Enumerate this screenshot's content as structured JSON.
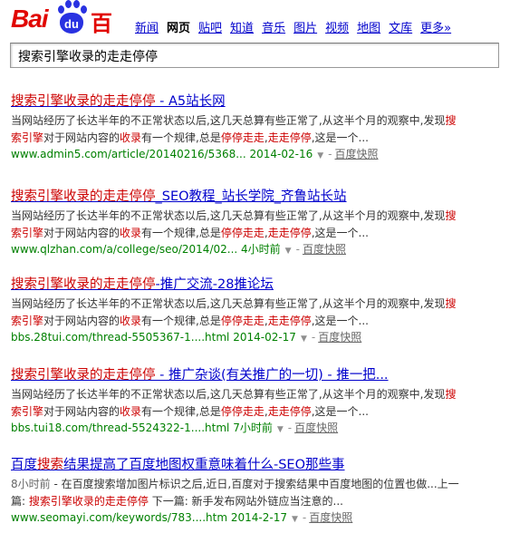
{
  "logo": {
    "part1": "Bai",
    "paw_text": "du",
    "part2": "百度"
  },
  "nav": {
    "items": [
      "新闻",
      "网页",
      "贴吧",
      "知道",
      "音乐",
      "图片",
      "视频",
      "地图",
      "文库",
      "更多»"
    ],
    "active": "网页"
  },
  "search": {
    "value": "搜索引擎收录的走走停停"
  },
  "results": [
    {
      "title_hl": "搜索引擎收录的走走停停",
      "title_rest": " - A5站长网",
      "abs_line1_a": "当网站经历了长达半年的不正常状态以后,这几天总算有些正常了,从这半个月的观察中,发现",
      "abs_line1_hl": "搜",
      "abs_line2_hl1": "索引擎",
      "abs_line2_a": "对于网站内容的",
      "abs_line2_hl2": "收录",
      "abs_line2_b": "有一个规律,总是",
      "abs_line2_hl3": "停停走走",
      "abs_line2_c": ",",
      "abs_line2_hl4": "走走停停",
      "abs_line2_d": ",这是一个...",
      "url": "www.admin5.com/article/20140216/5368...",
      "date": "2014-02-16",
      "cache": "百度快照"
    },
    {
      "title_hl": "搜索引擎收录的走走停停",
      "title_rest": "_SEO教程_站长学院_齐鲁站长站",
      "abs_line1_a": "当网站经历了长达半年的不正常状态以后,这几天总算有些正常了,从这半个月的观察中,发现",
      "abs_line1_hl": "搜",
      "abs_line2_hl1": "索引擎",
      "abs_line2_a": "对于网站内容的",
      "abs_line2_hl2": "收录",
      "abs_line2_b": "有一个规律,总是",
      "abs_line2_hl3": "停停走走",
      "abs_line2_c": ",",
      "abs_line2_hl4": "走走停停",
      "abs_line2_d": ",这是一个...",
      "url": "www.qlzhan.com/a/college/seo/2014/02...",
      "date": "4小时前",
      "cache": "百度快照"
    },
    {
      "title_hl": "搜索引擎收录的走走停停",
      "title_rest": "-推广交流-28推论坛",
      "abs_line1_a": "当网站经历了长达半年的不正常状态以后,这几天总算有些正常了,从这半个月的观察中,发现",
      "abs_line1_hl": "搜",
      "abs_line2_hl1": "索引擎",
      "abs_line2_a": "对于网站内容的",
      "abs_line2_hl2": "收录",
      "abs_line2_b": "有一个规律,总是",
      "abs_line2_hl3": "停停走走",
      "abs_line2_c": ",",
      "abs_line2_hl4": "走走停停",
      "abs_line2_d": ",这是一个...",
      "url": "bbs.28tui.com/thread-5505367-1....html",
      "date": "2014-02-17",
      "cache": "百度快照"
    },
    {
      "title_hl": "搜索引擎收录的走走停停",
      "title_rest": " - 推广杂谈(有关推广的一切) - 推一把...",
      "abs_line1_a": "当网站经历了长达半年的不正常状态以后,这几天总算有些正常了,从这半个月的观察中,发现",
      "abs_line1_hl": "搜",
      "abs_line2_hl1": "索引擎",
      "abs_line2_a": "对于网站内容的",
      "abs_line2_hl2": "收录",
      "abs_line2_b": "有一个规律,总是",
      "abs_line2_hl3": "停停走走",
      "abs_line2_c": ",",
      "abs_line2_hl4": "走走停停",
      "abs_line2_d": ",这是一个...",
      "url": "bbs.tui18.com/thread-5524322-1....html",
      "date": "7小时前",
      "cache": "百度快照"
    }
  ],
  "result5": {
    "title_a": "百度",
    "title_hl": "搜索",
    "title_b": "结果提高了百度地图权重意味着什么-SEO那些事",
    "abs_time": "8小时前",
    "abs_line1": " - 在百度搜索增加图片标识之后,近日,百度对于搜索结果中百度地图的位置也做...上一",
    "abs_line2_a": "篇: ",
    "abs_line2_hl": "搜索引擎收录的走走停停",
    "abs_line2_b": " 下一篇: 新手发布网站外链应当注意的...",
    "url": "www.seomayi.com/keywords/783....htm",
    "date": "2014-2-17",
    "cache": "百度快照"
  },
  "colors": {
    "link": "#0000cc",
    "highlight": "#cc0000",
    "url": "#008000",
    "brand_red": "#e10601",
    "brand_blue": "#2932e1"
  }
}
